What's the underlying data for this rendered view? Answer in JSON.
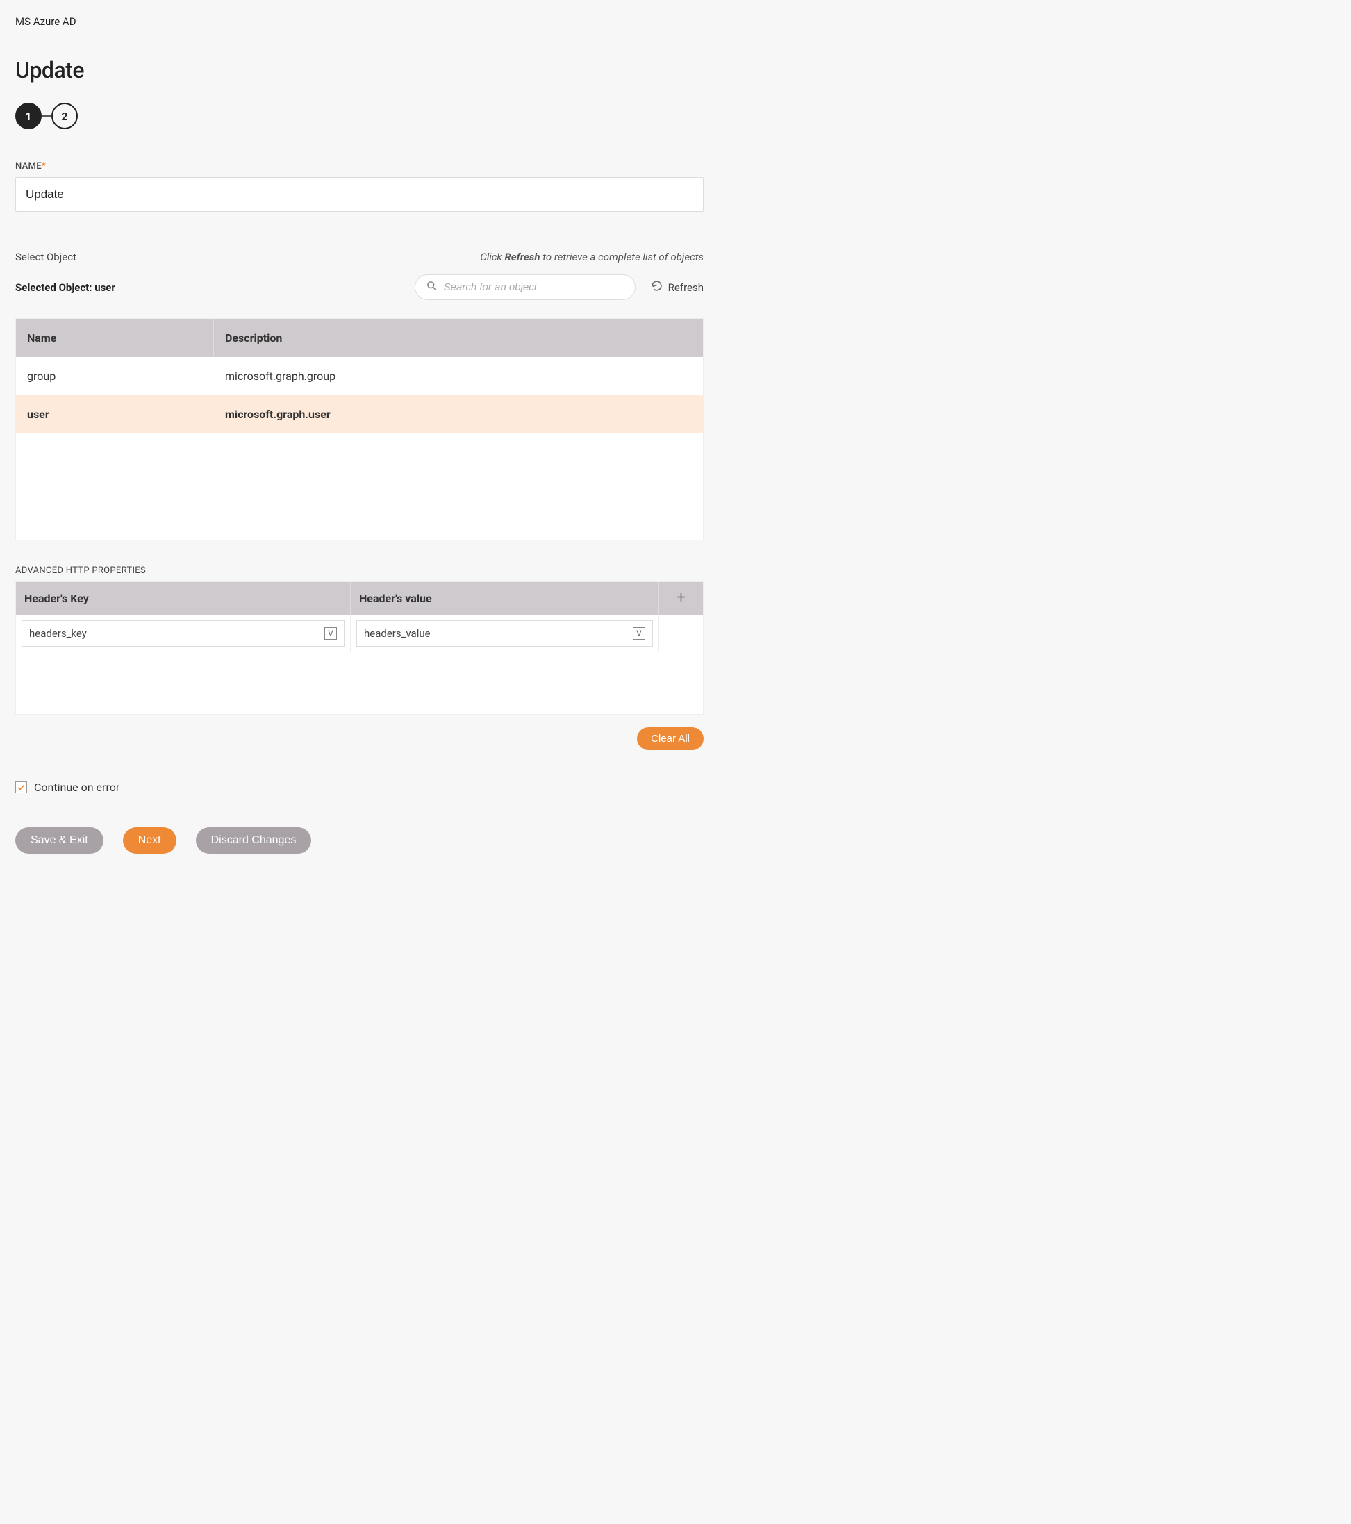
{
  "breadcrumb": "MS Azure AD",
  "page_title": "Update",
  "stepper": {
    "current": 1,
    "steps": [
      "1",
      "2"
    ]
  },
  "name_field": {
    "label": "NAME",
    "required": true,
    "value": "Update"
  },
  "select_object": {
    "label": "Select Object",
    "hint_prefix": "Click ",
    "hint_bold": "Refresh",
    "hint_suffix": " to retrieve a complete list of objects",
    "selected_label": "Selected Object: user",
    "search_placeholder": "Search for an object",
    "refresh_label": "Refresh",
    "columns": {
      "name": "Name",
      "description": "Description"
    },
    "rows": [
      {
        "name": "group",
        "description": "microsoft.graph.group",
        "selected": false
      },
      {
        "name": "user",
        "description": "microsoft.graph.user",
        "selected": true
      }
    ]
  },
  "advanced": {
    "label": "ADVANCED HTTP PROPERTIES",
    "columns": {
      "key": "Header's Key",
      "value": "Header's value"
    },
    "rows": [
      {
        "key": "headers_key",
        "value": "headers_value"
      }
    ],
    "clear_all": "Clear All",
    "add_icon": "+"
  },
  "continue_on_error": {
    "label": "Continue on error",
    "checked": true
  },
  "footer": {
    "save_exit": "Save & Exit",
    "next": "Next",
    "discard": "Discard Changes"
  }
}
